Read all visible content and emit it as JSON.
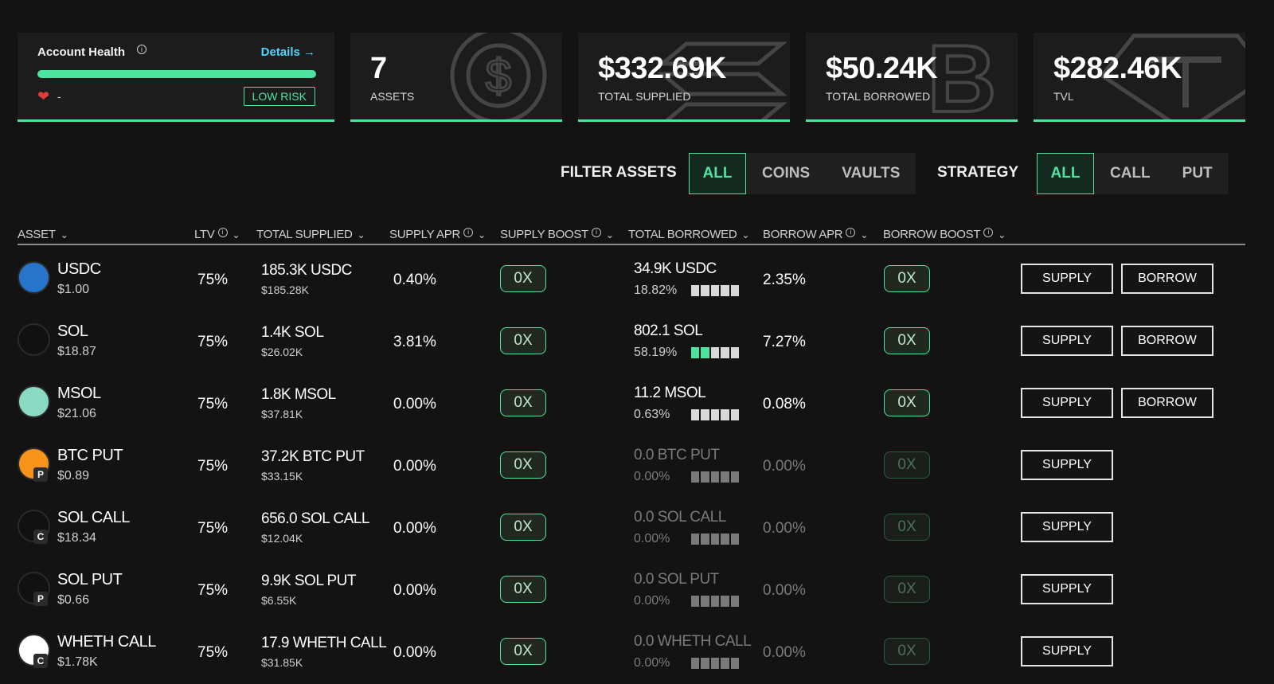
{
  "health_card": {
    "title": "Account Health",
    "info_icon": "info-icon",
    "details_label": "Details →",
    "health_level": 1.0,
    "health_value": "-",
    "risk_badge": "LOW RISK",
    "accent": "#4fe3a0"
  },
  "stats": [
    {
      "value": "7",
      "label": "ASSETS",
      "icon": "usdc-watermark-icon"
    },
    {
      "value": "$332.69K",
      "label": "TOTAL SUPPLIED",
      "icon": "sol-watermark-icon"
    },
    {
      "value": "$50.24K",
      "label": "TOTAL BORROWED",
      "icon": "btc-watermark-icon"
    },
    {
      "value": "$282.46K",
      "label": "TVL",
      "icon": "tether-watermark-icon"
    }
  ],
  "filters": {
    "filter_label": "FILTER ASSETS",
    "filter_options": [
      "ALL",
      "COINS",
      "VAULTS"
    ],
    "filter_selected": "ALL",
    "strategy_label": "STRATEGY",
    "strategy_options": [
      "ALL",
      "CALL",
      "PUT"
    ],
    "strategy_selected": "ALL"
  },
  "table": {
    "headers": {
      "asset": "ASSET",
      "ltv": "LTV",
      "total_supplied": "TOTAL SUPPLIED",
      "supply_apr": "SUPPLY APR",
      "supply_boost": "SUPPLY BOOST",
      "total_borrowed": "TOTAL BORROWED",
      "borrow_apr": "BORROW APR",
      "borrow_boost": "BORROW BOOST"
    },
    "rows": [
      {
        "name": "USDC",
        "price": "$1.00",
        "ltv": "75%",
        "supplied": "185.3K USDC",
        "supplied_usd": "$185.28K",
        "supply_apr": "0.40%",
        "supply_boost": "0X",
        "borrowed": "34.9K  USDC",
        "borrowed_pct": "18.82%",
        "util_segments": 0,
        "borrow_apr": "2.35%",
        "borrow_boost": "0X",
        "supply_btn": "SUPPLY",
        "borrow_btn": "BORROW",
        "badge": "",
        "icon_color": "#2775ca"
      },
      {
        "name": "SOL",
        "price": "$18.87",
        "ltv": "75%",
        "supplied": "1.4K SOL",
        "supplied_usd": "$26.02K",
        "supply_apr": "3.81%",
        "supply_boost": "0X",
        "borrowed": "802.1  SOL",
        "borrowed_pct": "58.19%",
        "util_segments": 2,
        "borrow_apr": "7.27%",
        "borrow_boost": "0X",
        "supply_btn": "SUPPLY",
        "borrow_btn": "BORROW",
        "badge": "",
        "icon_color": "#111111"
      },
      {
        "name": "MSOL",
        "price": "$21.06",
        "ltv": "75%",
        "supplied": "1.8K MSOL",
        "supplied_usd": "$37.81K",
        "supply_apr": "0.00%",
        "supply_boost": "0X",
        "borrowed": "11.2  MSOL",
        "borrowed_pct": "0.63%",
        "util_segments": 0,
        "borrow_apr": "0.08%",
        "borrow_boost": "0X",
        "supply_btn": "SUPPLY",
        "borrow_btn": "BORROW",
        "badge": "",
        "icon_color": "#8ad9c3"
      },
      {
        "name": "BTC PUT",
        "price": "$0.89",
        "ltv": "75%",
        "supplied": "37.2K BTC PUT",
        "supplied_usd": "$33.15K",
        "supply_apr": "0.00%",
        "supply_boost": "0X",
        "borrowed": "0.0  BTC PUT",
        "borrowed_pct": "0.00%",
        "util_segments": 0,
        "borrow_apr": "0.00%",
        "borrow_boost": "0X",
        "supply_btn": "SUPPLY",
        "borrow_btn": "",
        "badge": "P",
        "icon_color": "#f7931a"
      },
      {
        "name": "SOL CALL",
        "price": "$18.34",
        "ltv": "75%",
        "supplied": "656.0 SOL CALL",
        "supplied_usd": "$12.04K",
        "supply_apr": "0.00%",
        "supply_boost": "0X",
        "borrowed": "0.0  SOL CALL",
        "borrowed_pct": "0.00%",
        "util_segments": 0,
        "borrow_apr": "0.00%",
        "borrow_boost": "0X",
        "supply_btn": "SUPPLY",
        "borrow_btn": "",
        "badge": "C",
        "icon_color": "#111111"
      },
      {
        "name": "SOL PUT",
        "price": "$0.66",
        "ltv": "75%",
        "supplied": "9.9K SOL PUT",
        "supplied_usd": "$6.55K",
        "supply_apr": "0.00%",
        "supply_boost": "0X",
        "borrowed": "0.0  SOL PUT",
        "borrowed_pct": "0.00%",
        "util_segments": 0,
        "borrow_apr": "0.00%",
        "borrow_boost": "0X",
        "supply_btn": "SUPPLY",
        "borrow_btn": "",
        "badge": "P",
        "icon_color": "#111111"
      },
      {
        "name": "WHETH CALL",
        "price": "$1.78K",
        "ltv": "75%",
        "supplied": "17.9 WHETH CALL",
        "supplied_usd": "$31.85K",
        "supply_apr": "0.00%",
        "supply_boost": "0X",
        "borrowed": "0.0  WHETH CALL",
        "borrowed_pct": "0.00%",
        "util_segments": 0,
        "borrow_apr": "0.00%",
        "borrow_boost": "0X",
        "supply_btn": "SUPPLY",
        "borrow_btn": "",
        "badge": "C",
        "icon_color": "#ffffff"
      }
    ]
  }
}
